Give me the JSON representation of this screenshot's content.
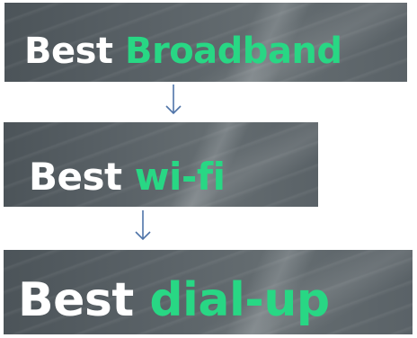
{
  "banners": [
    {
      "first": "Best",
      "second": "Broadband"
    },
    {
      "first": "Best",
      "second": "wi-fi"
    },
    {
      "first": "Best",
      "second": "dial-up"
    }
  ],
  "colors": {
    "accent_green": "#28d784",
    "text_white": "#ffffff",
    "banner_bg": "#5a6267",
    "arrow": "#4f74a8"
  },
  "arrows": [
    {
      "icon": "down-arrow-icon"
    },
    {
      "icon": "down-arrow-icon"
    }
  ]
}
